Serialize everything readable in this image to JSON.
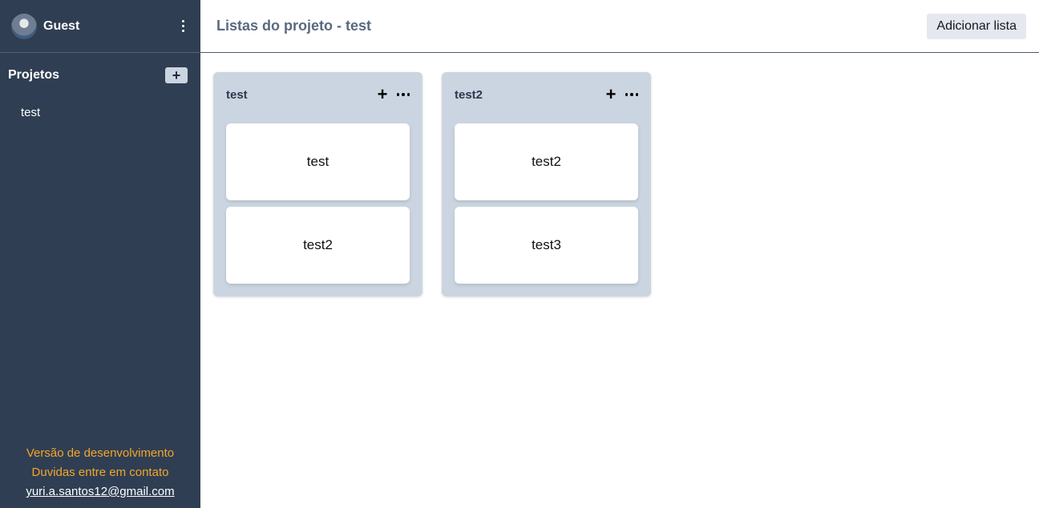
{
  "sidebar": {
    "user": {
      "name": "Guest"
    },
    "projects_title": "Projetos",
    "add_project_label": "+",
    "projects": [
      "test"
    ],
    "footer": {
      "line1": "Versão de desenvolvimento",
      "line2": "Duvidas entre em contato",
      "email": "yuri.a.santos12@gmail.com"
    }
  },
  "header": {
    "title": "Listas do projeto - test",
    "add_list_label": "Adicionar lista"
  },
  "board": {
    "lists": [
      {
        "title": "test",
        "add_label": "+",
        "cards": [
          "test",
          "test2"
        ]
      },
      {
        "title": "test2",
        "add_label": "+",
        "cards": [
          "test2",
          "test3"
        ]
      }
    ]
  },
  "colors": {
    "sidebar_bg": "#2f3e53",
    "list_bg": "#cbd5e1",
    "footer_accent": "#f4a62a"
  }
}
